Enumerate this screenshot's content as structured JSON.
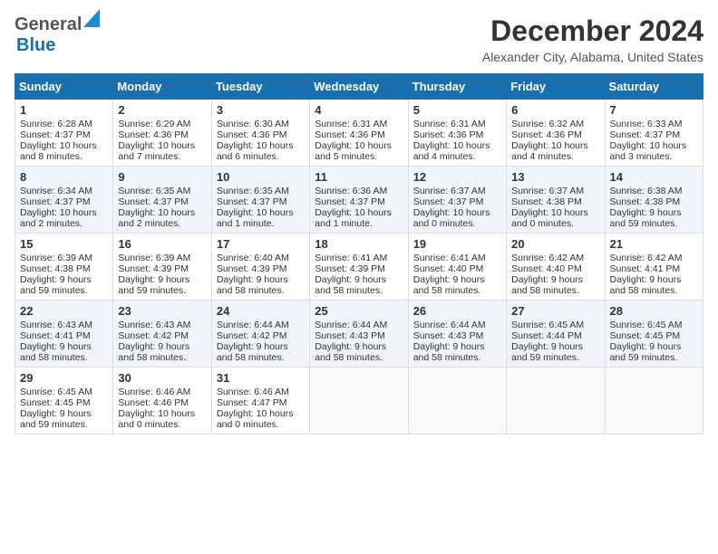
{
  "header": {
    "logo_general": "General",
    "logo_blue": "Blue",
    "month_title": "December 2024",
    "location": "Alexander City, Alabama, United States"
  },
  "days_of_week": [
    "Sunday",
    "Monday",
    "Tuesday",
    "Wednesday",
    "Thursday",
    "Friday",
    "Saturday"
  ],
  "weeks": [
    [
      {
        "day": "1",
        "sunrise": "Sunrise: 6:28 AM",
        "sunset": "Sunset: 4:37 PM",
        "daylight": "Daylight: 10 hours and 8 minutes."
      },
      {
        "day": "2",
        "sunrise": "Sunrise: 6:29 AM",
        "sunset": "Sunset: 4:36 PM",
        "daylight": "Daylight: 10 hours and 7 minutes."
      },
      {
        "day": "3",
        "sunrise": "Sunrise: 6:30 AM",
        "sunset": "Sunset: 4:36 PM",
        "daylight": "Daylight: 10 hours and 6 minutes."
      },
      {
        "day": "4",
        "sunrise": "Sunrise: 6:31 AM",
        "sunset": "Sunset: 4:36 PM",
        "daylight": "Daylight: 10 hours and 5 minutes."
      },
      {
        "day": "5",
        "sunrise": "Sunrise: 6:31 AM",
        "sunset": "Sunset: 4:36 PM",
        "daylight": "Daylight: 10 hours and 4 minutes."
      },
      {
        "day": "6",
        "sunrise": "Sunrise: 6:32 AM",
        "sunset": "Sunset: 4:36 PM",
        "daylight": "Daylight: 10 hours and 4 minutes."
      },
      {
        "day": "7",
        "sunrise": "Sunrise: 6:33 AM",
        "sunset": "Sunset: 4:37 PM",
        "daylight": "Daylight: 10 hours and 3 minutes."
      }
    ],
    [
      {
        "day": "8",
        "sunrise": "Sunrise: 6:34 AM",
        "sunset": "Sunset: 4:37 PM",
        "daylight": "Daylight: 10 hours and 2 minutes."
      },
      {
        "day": "9",
        "sunrise": "Sunrise: 6:35 AM",
        "sunset": "Sunset: 4:37 PM",
        "daylight": "Daylight: 10 hours and 2 minutes."
      },
      {
        "day": "10",
        "sunrise": "Sunrise: 6:35 AM",
        "sunset": "Sunset: 4:37 PM",
        "daylight": "Daylight: 10 hours and 1 minute."
      },
      {
        "day": "11",
        "sunrise": "Sunrise: 6:36 AM",
        "sunset": "Sunset: 4:37 PM",
        "daylight": "Daylight: 10 hours and 1 minute."
      },
      {
        "day": "12",
        "sunrise": "Sunrise: 6:37 AM",
        "sunset": "Sunset: 4:37 PM",
        "daylight": "Daylight: 10 hours and 0 minutes."
      },
      {
        "day": "13",
        "sunrise": "Sunrise: 6:37 AM",
        "sunset": "Sunset: 4:38 PM",
        "daylight": "Daylight: 10 hours and 0 minutes."
      },
      {
        "day": "14",
        "sunrise": "Sunrise: 6:38 AM",
        "sunset": "Sunset: 4:38 PM",
        "daylight": "Daylight: 9 hours and 59 minutes."
      }
    ],
    [
      {
        "day": "15",
        "sunrise": "Sunrise: 6:39 AM",
        "sunset": "Sunset: 4:38 PM",
        "daylight": "Daylight: 9 hours and 59 minutes."
      },
      {
        "day": "16",
        "sunrise": "Sunrise: 6:39 AM",
        "sunset": "Sunset: 4:39 PM",
        "daylight": "Daylight: 9 hours and 59 minutes."
      },
      {
        "day": "17",
        "sunrise": "Sunrise: 6:40 AM",
        "sunset": "Sunset: 4:39 PM",
        "daylight": "Daylight: 9 hours and 58 minutes."
      },
      {
        "day": "18",
        "sunrise": "Sunrise: 6:41 AM",
        "sunset": "Sunset: 4:39 PM",
        "daylight": "Daylight: 9 hours and 58 minutes."
      },
      {
        "day": "19",
        "sunrise": "Sunrise: 6:41 AM",
        "sunset": "Sunset: 4:40 PM",
        "daylight": "Daylight: 9 hours and 58 minutes."
      },
      {
        "day": "20",
        "sunrise": "Sunrise: 6:42 AM",
        "sunset": "Sunset: 4:40 PM",
        "daylight": "Daylight: 9 hours and 58 minutes."
      },
      {
        "day": "21",
        "sunrise": "Sunrise: 6:42 AM",
        "sunset": "Sunset: 4:41 PM",
        "daylight": "Daylight: 9 hours and 58 minutes."
      }
    ],
    [
      {
        "day": "22",
        "sunrise": "Sunrise: 6:43 AM",
        "sunset": "Sunset: 4:41 PM",
        "daylight": "Daylight: 9 hours and 58 minutes."
      },
      {
        "day": "23",
        "sunrise": "Sunrise: 6:43 AM",
        "sunset": "Sunset: 4:42 PM",
        "daylight": "Daylight: 9 hours and 58 minutes."
      },
      {
        "day": "24",
        "sunrise": "Sunrise: 6:44 AM",
        "sunset": "Sunset: 4:42 PM",
        "daylight": "Daylight: 9 hours and 58 minutes."
      },
      {
        "day": "25",
        "sunrise": "Sunrise: 6:44 AM",
        "sunset": "Sunset: 4:43 PM",
        "daylight": "Daylight: 9 hours and 58 minutes."
      },
      {
        "day": "26",
        "sunrise": "Sunrise: 6:44 AM",
        "sunset": "Sunset: 4:43 PM",
        "daylight": "Daylight: 9 hours and 58 minutes."
      },
      {
        "day": "27",
        "sunrise": "Sunrise: 6:45 AM",
        "sunset": "Sunset: 4:44 PM",
        "daylight": "Daylight: 9 hours and 59 minutes."
      },
      {
        "day": "28",
        "sunrise": "Sunrise: 6:45 AM",
        "sunset": "Sunset: 4:45 PM",
        "daylight": "Daylight: 9 hours and 59 minutes."
      }
    ],
    [
      {
        "day": "29",
        "sunrise": "Sunrise: 6:45 AM",
        "sunset": "Sunset: 4:45 PM",
        "daylight": "Daylight: 9 hours and 59 minutes."
      },
      {
        "day": "30",
        "sunrise": "Sunrise: 6:46 AM",
        "sunset": "Sunset: 4:46 PM",
        "daylight": "Daylight: 10 hours and 0 minutes."
      },
      {
        "day": "31",
        "sunrise": "Sunrise: 6:46 AM",
        "sunset": "Sunset: 4:47 PM",
        "daylight": "Daylight: 10 hours and 0 minutes."
      },
      null,
      null,
      null,
      null
    ]
  ]
}
